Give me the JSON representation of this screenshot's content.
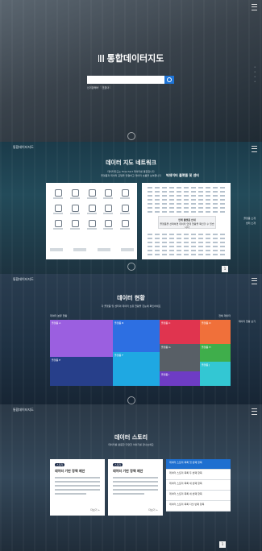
{
  "section1": {
    "title": "통합데이터지도",
    "search": {
      "placeholder": "검색어를 입력하세요"
    },
    "keywords": [
      "인기검색어",
      "코로나"
    ],
    "side_links": [
      "•",
      "•",
      "•",
      "•"
    ]
  },
  "section2": {
    "logo": "통합데이터지도",
    "title": "데이터 지도 네트워크",
    "description": [
      "데이터지도는 flowchart 데이터를 통합합니다",
      "플랫폼과 데이터 포털을 연결하고 데이터 흐름을 보여줍니다"
    ],
    "map_caption": "빅데이터 플랫폼 및 센터",
    "map_notice": {
      "title": "연계 플랫폼 안내",
      "text": "플랫폼을 선택하면 데이터 연계 현황을 확인할 수 있습니다"
    },
    "icons": [
      "금융",
      "환경",
      "문화",
      "교통",
      "통신",
      "유통",
      "산림",
      "헬스",
      "중소",
      "지역",
      "농식품",
      "해양",
      "라이프",
      "교육",
      "기타"
    ],
    "side_links": [
      "플랫폼 소개",
      "센터 소개"
    ],
    "page": "1"
  },
  "section3": {
    "logo": "통합데이터지도",
    "title": "데이터 현황",
    "description": "각 플랫폼 및 센터의 데이터 보유 현황을 한눈에 확인하세요",
    "head_left": "데이터 분류 현황",
    "head_right": "전체 데이터",
    "tiles": [
      {
        "label": "플랫폼 A",
        "color": "#9b5fe0"
      },
      {
        "label": "플랫폼 B",
        "color": "#2d6fe2"
      },
      {
        "label": "플랫폼 C",
        "color": "#e0344f"
      },
      {
        "label": "플랫폼 D",
        "color": "#f0703a"
      },
      {
        "label": "플랫폼 E",
        "color": "#273f8a"
      },
      {
        "label": "플랫폼 F",
        "color": "#1fa8e2"
      },
      {
        "label": "플랫폼 G",
        "color": "#585f66"
      },
      {
        "label": "플랫폼 H",
        "color": "#3fae4b"
      },
      {
        "label": "플랫폼 I",
        "color": "#6e3cc4"
      },
      {
        "label": "플랫폼 J",
        "color": "#33c7d3"
      }
    ],
    "side_links": [
      "데이터 현황 보기"
    ]
  },
  "section4": {
    "logo": "통합데이터지도",
    "title": "데이터 스토리",
    "description": "데이터를 활용한 다양한 이야기를 만나보세요",
    "cards": [
      {
        "tag": "스토리",
        "headline": "데이터 기반 정책 제안",
        "more": "더보기 +"
      },
      {
        "tag": "스토리",
        "headline": "데이터 기반 정책 제안",
        "more": "더보기 +"
      }
    ],
    "list": [
      "데이터 스토리 목록 첫 번째 항목",
      "데이터 스토리 목록 두 번째 항목",
      "데이터 스토리 목록 세 번째 항목",
      "데이터 스토리 목록 네 번째 항목",
      "데이터 스토리 목록 다섯 번째 항목"
    ],
    "page": "1"
  }
}
